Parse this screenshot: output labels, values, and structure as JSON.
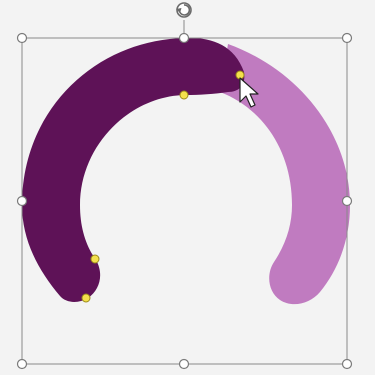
{
  "shape": {
    "kind": "block-arc",
    "dark_segment_color": "#5e1257",
    "light_segment_color": "#c07bc0",
    "fill_fraction_dark": 0.6
  },
  "selection": {
    "border_color": "#8a8a8a",
    "handle_fill": "#ffffff",
    "handle_stroke": "#7a7a7a",
    "adjust_handle_fill": "#f4e04d",
    "adjust_handle_stroke": "#9b8a1a"
  },
  "icons": {
    "rotate": "rotate-icon",
    "cursor": "mouse-pointer-icon"
  }
}
